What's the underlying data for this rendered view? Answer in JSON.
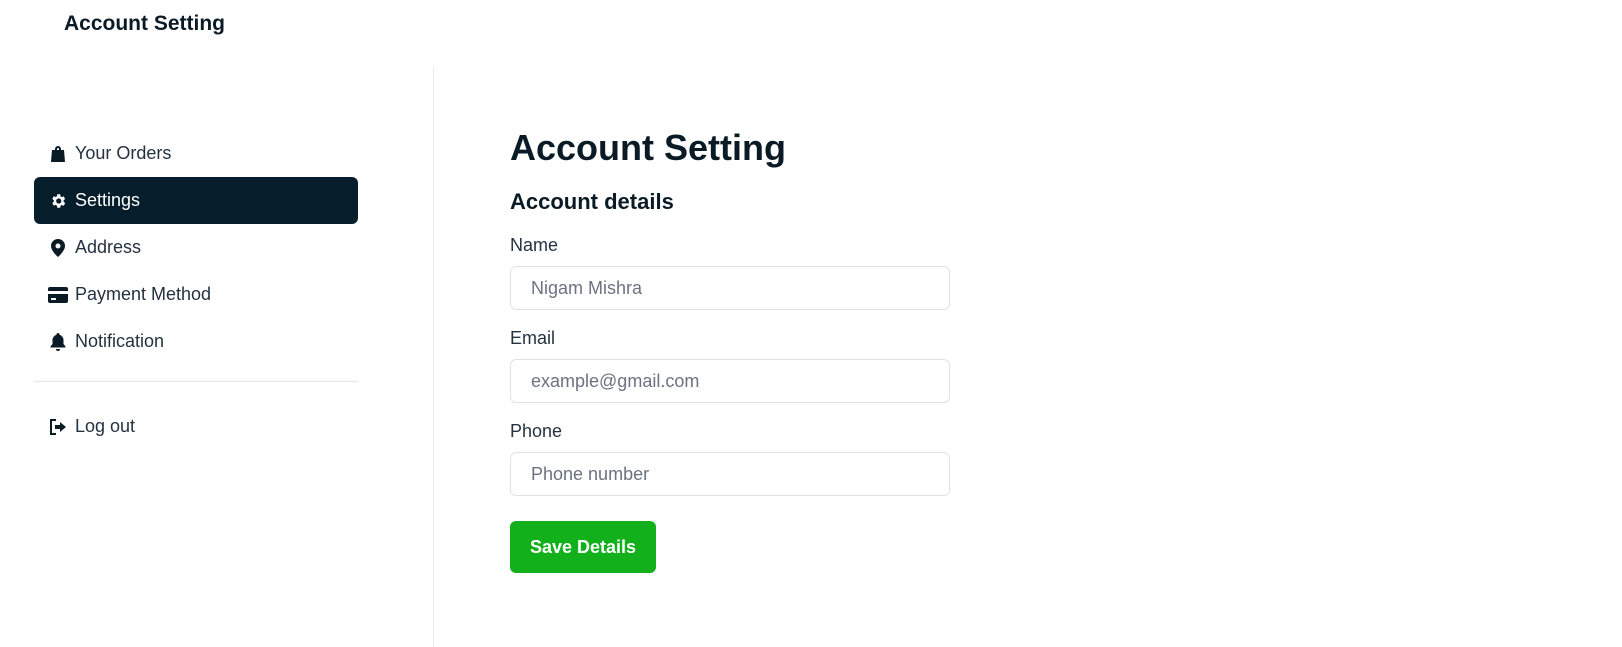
{
  "header": {
    "title": "Account Setting"
  },
  "sidebar": {
    "items": [
      {
        "label": "Your Orders",
        "icon": "shopping-bag-icon",
        "active": false
      },
      {
        "label": "Settings",
        "icon": "gear-icon",
        "active": true
      },
      {
        "label": "Address",
        "icon": "map-pin-icon",
        "active": false
      },
      {
        "label": "Payment Method",
        "icon": "credit-card-icon",
        "active": false
      },
      {
        "label": "Notification",
        "icon": "bell-icon",
        "active": false
      }
    ],
    "logout": {
      "label": "Log out",
      "icon": "logout-icon"
    }
  },
  "main": {
    "title": "Account Setting",
    "section_title": "Account details",
    "fields": {
      "name": {
        "label": "Name",
        "placeholder": "Nigam Mishra",
        "value": ""
      },
      "email": {
        "label": "Email",
        "placeholder": "example@gmail.com",
        "value": ""
      },
      "phone": {
        "label": "Phone",
        "placeholder": "Phone number",
        "value": ""
      }
    },
    "save_label": "Save Details"
  },
  "colors": {
    "sidebar_active_bg": "#061d2b",
    "save_button_bg": "#12b01b",
    "text_dark": "#0b1b26"
  }
}
